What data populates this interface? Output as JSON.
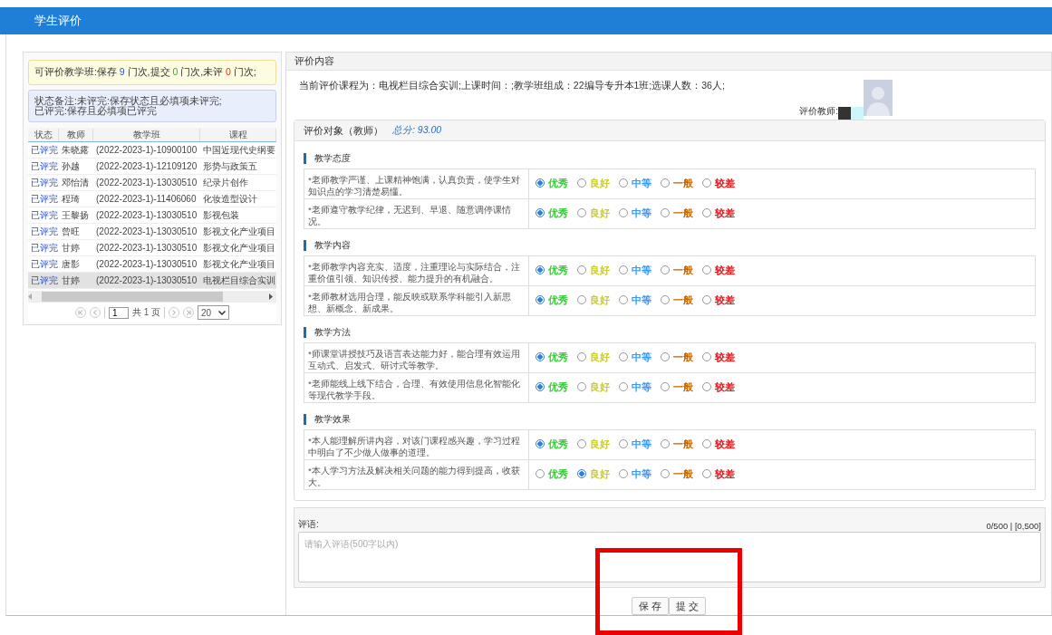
{
  "header": {
    "title": "学生评价"
  },
  "summary": {
    "parts": [
      {
        "kind": "label",
        "text": "可评价教学班:保存 "
      },
      {
        "kind": "saved",
        "text": "9"
      },
      {
        "kind": "label",
        "text": " 门次,提交 "
      },
      {
        "kind": "submitted",
        "text": "0"
      },
      {
        "kind": "label",
        "text": " 门次,未评 "
      },
      {
        "kind": "pending",
        "text": "0"
      },
      {
        "kind": "label",
        "text": " 门次;"
      }
    ]
  },
  "note": {
    "lines": [
      "状态备注:未评完:保存状态且必填项未评完;",
      "已评完:保存且必填项已评完"
    ]
  },
  "table": {
    "columns": [
      "状态",
      "教师",
      "教学班",
      "课程"
    ],
    "rows": [
      {
        "selected": false,
        "cells": [
          "已评完",
          "朱晓露",
          "(2022-2023-1)-10900100",
          "中国近现代史纲要"
        ]
      },
      {
        "selected": false,
        "cells": [
          "已评完",
          "孙越",
          "(2022-2023-1)-12109120",
          "形势与政策五"
        ]
      },
      {
        "selected": false,
        "cells": [
          "已评完",
          "邓怡清",
          "(2022-2023-1)-13030510",
          "纪录片创作"
        ]
      },
      {
        "selected": false,
        "cells": [
          "已评完",
          "程琦",
          "(2022-2023-1)-11406060",
          "化妆造型设计"
        ]
      },
      {
        "selected": false,
        "cells": [
          "已评完",
          "王黎扬",
          "(2022-2023-1)-13030510",
          "影视包装"
        ]
      },
      {
        "selected": false,
        "cells": [
          "已评完",
          "曾旺",
          "(2022-2023-1)-13030510",
          "影视文化产业项目"
        ]
      },
      {
        "selected": false,
        "cells": [
          "已评完",
          "甘婷",
          "(2022-2023-1)-13030510",
          "影视文化产业项目"
        ]
      },
      {
        "selected": false,
        "cells": [
          "已评完",
          "唐影",
          "(2022-2023-1)-13030510",
          "影视文化产业项目"
        ]
      },
      {
        "selected": true,
        "cells": [
          "已评完",
          "甘婷",
          "(2022-2023-1)-13030510",
          "电视栏目综合实训"
        ]
      }
    ]
  },
  "pager": {
    "page": "1",
    "total": "共 1 页",
    "page_size": "20"
  },
  "content": {
    "title": "评价内容",
    "info": "当前评价课程为：电视栏目综合实训;上课时间：;教学班组成：22编导专升本1班;选课人数：36人;",
    "evaluator_label": "评价教师:"
  },
  "evaluation": {
    "title": "评价对象（教师）",
    "score": "总分: 93.00",
    "sections": [
      {
        "title": "教学态度",
        "questions": [
          {
            "text": "*老师教学严谨、上课精神饱满，认真负责，使学生对知识点的学习清楚易懂。",
            "options": [
              {
                "label": "优秀",
                "color": "#33cc33",
                "selected": true
              },
              {
                "label": "良好",
                "color": "#cccc22",
                "selected": false
              },
              {
                "label": "中等",
                "color": "#3399ff",
                "selected": false
              },
              {
                "label": "一般",
                "color": "#cc6600",
                "selected": false
              },
              {
                "label": "较差",
                "color": "#ee1111",
                "selected": false
              }
            ]
          },
          {
            "text": "*老师遵守教学纪律，无迟到、早退、随意调停课情况。",
            "options": [
              {
                "label": "优秀",
                "color": "#33cc33",
                "selected": true
              },
              {
                "label": "良好",
                "color": "#cccc22",
                "selected": false
              },
              {
                "label": "中等",
                "color": "#3399ff",
                "selected": false
              },
              {
                "label": "一般",
                "color": "#cc6600",
                "selected": false
              },
              {
                "label": "较差",
                "color": "#ee1111",
                "selected": false
              }
            ]
          }
        ]
      },
      {
        "title": "教学内容",
        "questions": [
          {
            "text": "*老师教学内容充实、适度，注重理论与实际结合，注重价值引领、知识传授、能力提升的有机融合。",
            "options": [
              {
                "label": "优秀",
                "color": "#33cc33",
                "selected": true
              },
              {
                "label": "良好",
                "color": "#cccc22",
                "selected": false
              },
              {
                "label": "中等",
                "color": "#3399ff",
                "selected": false
              },
              {
                "label": "一般",
                "color": "#cc6600",
                "selected": false
              },
              {
                "label": "较差",
                "color": "#ee1111",
                "selected": false
              }
            ]
          },
          {
            "text": "*老师教材选用合理，能反映或联系学科能引入新思想、新概念、新成果。",
            "options": [
              {
                "label": "优秀",
                "color": "#33cc33",
                "selected": true
              },
              {
                "label": "良好",
                "color": "#cccc22",
                "selected": false
              },
              {
                "label": "中等",
                "color": "#3399ff",
                "selected": false
              },
              {
                "label": "一般",
                "color": "#cc6600",
                "selected": false
              },
              {
                "label": "较差",
                "color": "#ee1111",
                "selected": false
              }
            ]
          }
        ]
      },
      {
        "title": "教学方法",
        "questions": [
          {
            "text": "*师课堂讲授技巧及语言表达能力好，能合理有效运用互动式、启发式、研讨式等教学。",
            "options": [
              {
                "label": "优秀",
                "color": "#33cc33",
                "selected": true
              },
              {
                "label": "良好",
                "color": "#cccc22",
                "selected": false
              },
              {
                "label": "中等",
                "color": "#3399ff",
                "selected": false
              },
              {
                "label": "一般",
                "color": "#cc6600",
                "selected": false
              },
              {
                "label": "较差",
                "color": "#ee1111",
                "selected": false
              }
            ]
          },
          {
            "text": "*老师能线上线下结合，合理、有效使用信息化智能化等现代教学手段。",
            "options": [
              {
                "label": "优秀",
                "color": "#33cc33",
                "selected": true
              },
              {
                "label": "良好",
                "color": "#cccc22",
                "selected": false
              },
              {
                "label": "中等",
                "color": "#3399ff",
                "selected": false
              },
              {
                "label": "一般",
                "color": "#cc6600",
                "selected": false
              },
              {
                "label": "较差",
                "color": "#ee1111",
                "selected": false
              }
            ]
          }
        ]
      },
      {
        "title": "教学效果",
        "questions": [
          {
            "text": "*本人能理解所讲内容，对该门课程感兴趣，学习过程中明白了不少做人做事的道理。",
            "options": [
              {
                "label": "优秀",
                "color": "#33cc33",
                "selected": true
              },
              {
                "label": "良好",
                "color": "#cccc22",
                "selected": false
              },
              {
                "label": "中等",
                "color": "#3399ff",
                "selected": false
              },
              {
                "label": "一般",
                "color": "#cc6600",
                "selected": false
              },
              {
                "label": "较差",
                "color": "#ee1111",
                "selected": false
              }
            ]
          },
          {
            "text": "*本人学习方法及解决相关问题的能力得到提高，收获大。",
            "options": [
              {
                "label": "优秀",
                "color": "#33cc33",
                "selected": false
              },
              {
                "label": "良好",
                "color": "#cccc22",
                "selected": true
              },
              {
                "label": "中等",
                "color": "#3399ff",
                "selected": false
              },
              {
                "label": "一般",
                "color": "#cc6600",
                "selected": false
              },
              {
                "label": "较差",
                "color": "#ee1111",
                "selected": false
              }
            ]
          }
        ]
      }
    ]
  },
  "comment": {
    "label": "评语:",
    "counter": "0/500 | [0,500]",
    "placeholder": "请输入评语(500字以内)"
  },
  "buttons": [
    "保 存",
    "提 交"
  ],
  "annotations": [
    {
      "kind": "rectangle"
    }
  ]
}
